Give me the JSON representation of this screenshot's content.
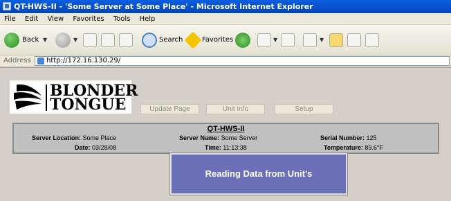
{
  "window": {
    "title": "QT-HWS-II - 'Some Server at Some Place' - Microsoft Internet Explorer"
  },
  "menu": [
    "File",
    "Edit",
    "View",
    "Favorites",
    "Tools",
    "Help"
  ],
  "toolbar": {
    "back_label": "Back",
    "search_label": "Search",
    "favorites_label": "Favorites"
  },
  "address": {
    "label": "Address",
    "url": "http://172.16.130.29/"
  },
  "logo": {
    "line1": "BLONDER",
    "line2": "TONGUE"
  },
  "nav": {
    "update_page": "Update Page",
    "unit_info": "Unit Info",
    "setup": "Setup"
  },
  "info": {
    "unit_name": "QT-HWS-II",
    "server_location_label": "Server Location:",
    "server_location": "Some Place",
    "server_name_label": "Server Name:",
    "server_name": "Some Server",
    "serial_label": "Serial Number:",
    "serial": "125",
    "date_label": "Date:",
    "date": "03/28/08",
    "time_label": "Time:",
    "time": "11:13:38",
    "temperature_label": "Temperature:",
    "temperature": "89.6°F"
  },
  "modal": {
    "message": "Reading Data from Unit's"
  },
  "colors": {
    "titlebar": "#0844b8",
    "page_bg": "#d4d0c8",
    "modal_bg": "#6b6fb8"
  }
}
